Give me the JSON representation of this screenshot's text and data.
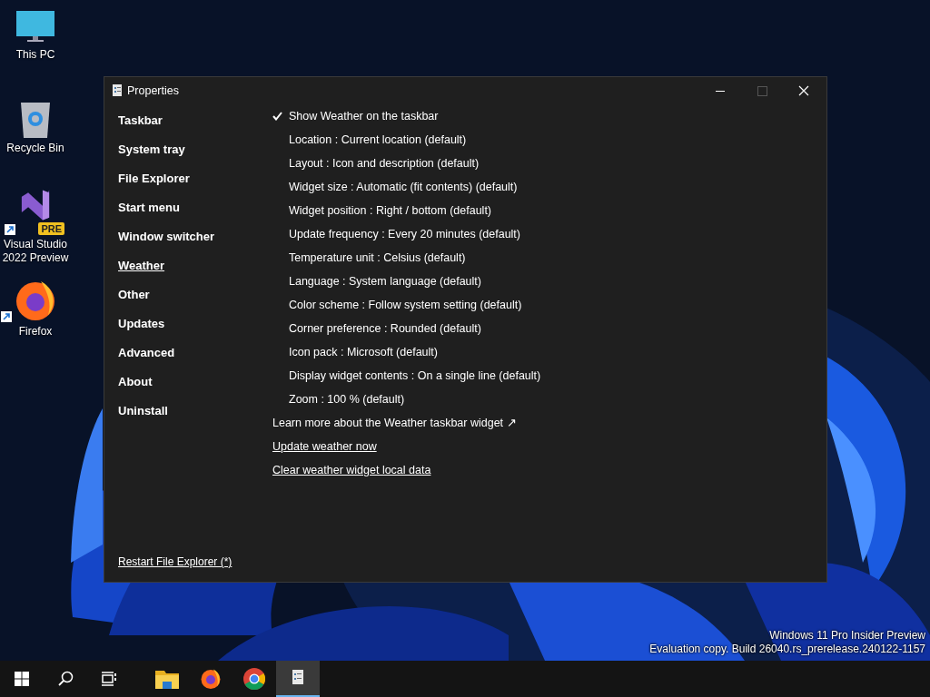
{
  "desktop_icons": [
    {
      "label": "This PC",
      "kind": "monitor"
    },
    {
      "label": "Recycle Bin",
      "kind": "bin"
    },
    {
      "label": "Visual Studio 2022 Preview",
      "kind": "vs",
      "badge": "PRE"
    },
    {
      "label": "Firefox",
      "kind": "firefox"
    }
  ],
  "window": {
    "title": "Properties",
    "nav": [
      {
        "label": "Taskbar",
        "selected": false
      },
      {
        "label": "System tray",
        "selected": false
      },
      {
        "label": "File Explorer",
        "selected": false
      },
      {
        "label": "Start menu",
        "selected": false
      },
      {
        "label": "Window switcher",
        "selected": false
      },
      {
        "label": "Weather",
        "selected": true
      },
      {
        "label": "Other",
        "selected": false
      },
      {
        "label": "Updates",
        "selected": false
      },
      {
        "label": "Advanced",
        "selected": false
      },
      {
        "label": "About",
        "selected": false
      },
      {
        "label": "Uninstall",
        "selected": false
      }
    ],
    "options": [
      {
        "label": "Show Weather on the taskbar",
        "checked": true
      },
      {
        "label": "Location : Current location (default)",
        "checked": false
      },
      {
        "label": "Layout : Icon and description (default)",
        "checked": false
      },
      {
        "label": "Widget size : Automatic (fit contents) (default)",
        "checked": false
      },
      {
        "label": "Widget position : Right / bottom (default)",
        "checked": false
      },
      {
        "label": "Update frequency : Every 20 minutes (default)",
        "checked": false
      },
      {
        "label": "Temperature unit : Celsius (default)",
        "checked": false
      },
      {
        "label": "Language : System language (default)",
        "checked": false
      },
      {
        "label": "Color scheme : Follow system setting (default)",
        "checked": false
      },
      {
        "label": "Corner preference : Rounded (default)",
        "checked": false
      },
      {
        "label": "Icon pack : Microsoft (default)",
        "checked": false
      },
      {
        "label": "Display widget contents : On a single line (default)",
        "checked": false
      },
      {
        "label": "Zoom : 100 % (default)",
        "checked": false
      }
    ],
    "links": [
      {
        "label": "Learn more about the Weather taskbar widget ↗",
        "kind": "plain"
      },
      {
        "label": "Update weather now",
        "kind": "underlined"
      },
      {
        "label": "Clear weather widget local data",
        "kind": "underlined"
      }
    ],
    "footer_link": "Restart File Explorer (*)"
  },
  "system_notice": [
    "Windows 11 Pro Insider Preview",
    "Evaluation copy. Build 26040.rs_prerelease.240122-1157"
  ],
  "taskbar": [
    {
      "kind": "start",
      "active": false
    },
    {
      "kind": "search",
      "active": false
    },
    {
      "kind": "taskview",
      "active": false
    },
    {
      "kind": "folder",
      "active": false
    },
    {
      "kind": "firefox",
      "active": false
    },
    {
      "kind": "chrome",
      "active": false
    },
    {
      "kind": "app",
      "active": true
    }
  ]
}
